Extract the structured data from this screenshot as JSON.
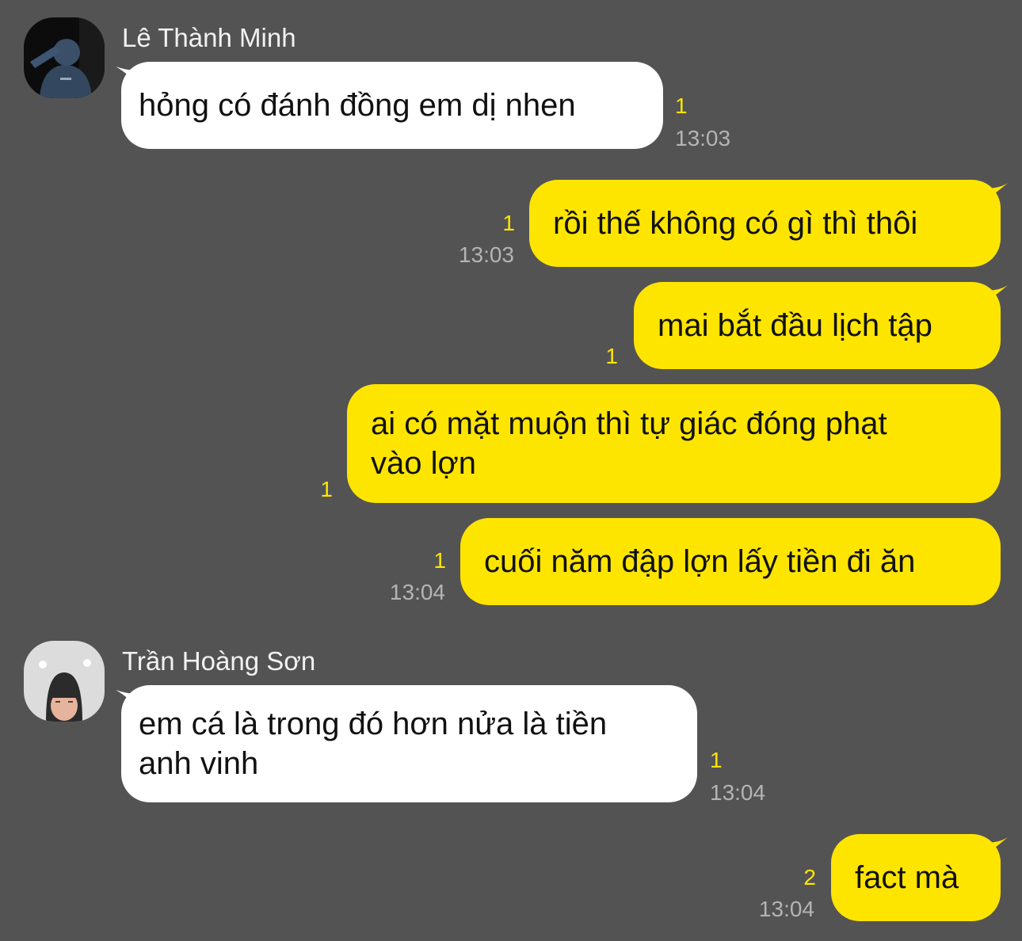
{
  "messages": [
    {
      "sender": "Lê Thành Minh",
      "lines": [
        "hỏng có đánh đồng em dị nhen"
      ],
      "unread": "1",
      "time": "13:03"
    },
    {
      "lines": [
        "rồi thế không có gì thì thôi"
      ],
      "unread": "1",
      "time": "13:03"
    },
    {
      "lines": [
        "mai bắt đầu lịch tập"
      ],
      "unread": "1"
    },
    {
      "lines": [
        "ai có mặt muộn thì tự giác đóng phạt",
        "vào lợn"
      ],
      "unread": "1"
    },
    {
      "lines": [
        "cuối năm đập lợn lấy tiền đi ăn"
      ],
      "unread": "1",
      "time": "13:04"
    },
    {
      "sender": "Trần Hoàng Sơn",
      "lines": [
        "em cá là trong đó hơn nửa là tiền",
        "anh vinh"
      ],
      "unread": "1",
      "time": "13:04"
    },
    {
      "lines": [
        "fact mà"
      ],
      "unread": "2",
      "time": "13:04"
    }
  ],
  "colors": {
    "background": "#545353",
    "incoming_bubble": "#ffffff",
    "outgoing_bubble": "#fee500",
    "unread_count": "#fee500",
    "timestamp": "#b4b4b4"
  }
}
